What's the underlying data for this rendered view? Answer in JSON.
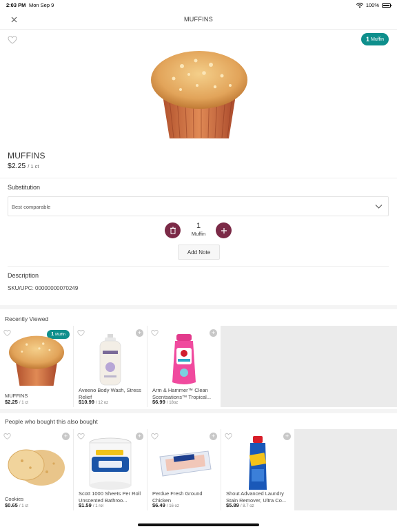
{
  "status_bar": {
    "time": "2:03 PM",
    "date": "Mon Sep 9",
    "battery": "100%"
  },
  "header": {
    "title": "MUFFINS"
  },
  "product": {
    "badge_qty": "1",
    "badge_unit": "Muffin",
    "name": "MUFFINS",
    "price": "$2.25",
    "unit": "/ 1 ct"
  },
  "substitution": {
    "label": "Substitution",
    "value": "Best comparable"
  },
  "stepper": {
    "value": "1",
    "unit": "Muffin"
  },
  "add_note_label": "Add Note",
  "description": {
    "label": "Description",
    "sku": "SKU/UPC: 00000000070249"
  },
  "recently_viewed": {
    "title": "Recently Viewed",
    "items": [
      {
        "name": "MUFFINS",
        "price": "$2.25",
        "unit": "/ 1 ct",
        "badge_qty": "1",
        "badge_unit": "Muffin"
      },
      {
        "name": "Aveeno Body Wash, Stress Relief",
        "price": "$10.99",
        "unit": "/ 12 oz"
      },
      {
        "name": "Arm & Hammer™ Clean Scentsations™ Tropical...",
        "price": "$6.99",
        "unit": "/ 18oz"
      }
    ]
  },
  "also_bought": {
    "title": "People who bought this also bought",
    "items": [
      {
        "name": "Cookies",
        "price": "$0.65",
        "unit": "/ 1 ct"
      },
      {
        "name": "Scott 1000 Sheets Per Roll Unscented Bathroo...",
        "price": "$1.59",
        "unit": "/ 1 rol"
      },
      {
        "name": "Perdue Fresh Ground Chicken",
        "price": "$6.49",
        "unit": "/ 16 oz"
      },
      {
        "name": "Shout Advanced Laundry Stain Remover, Ultra Co...",
        "price": "$5.89",
        "unit": "/ 8.7 oz"
      }
    ]
  },
  "colors": {
    "accent": "#0e8f8c",
    "stepper": "#7b2a47"
  }
}
